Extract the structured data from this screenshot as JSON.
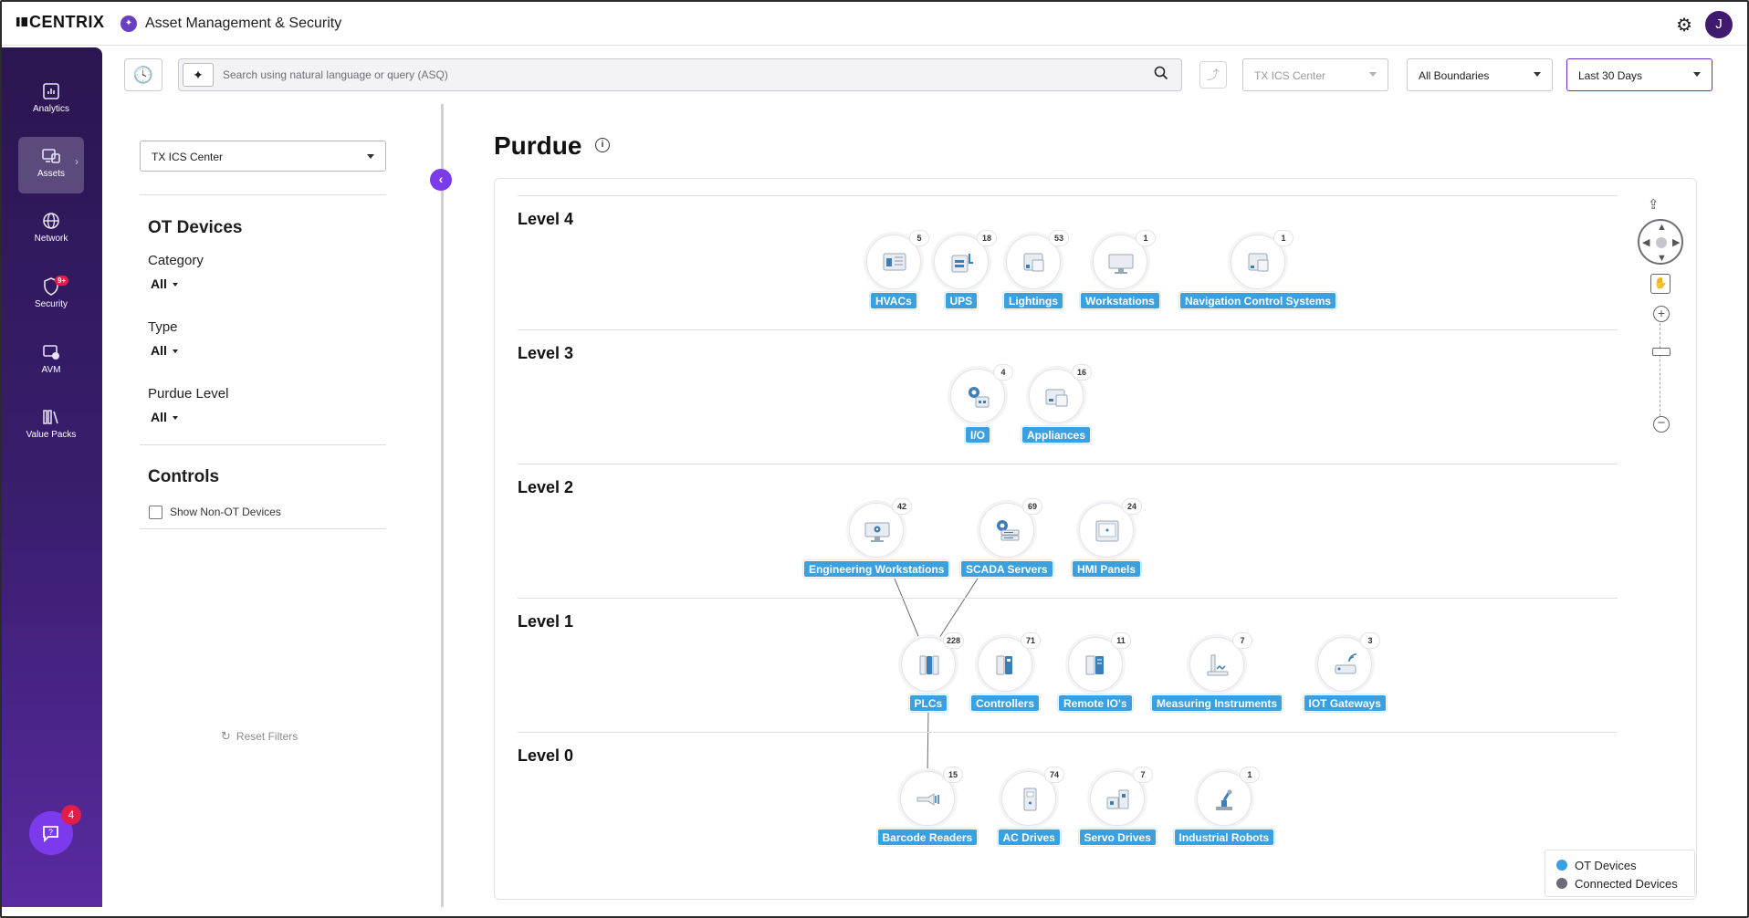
{
  "header": {
    "brand": "CENTRIX",
    "app_title": "Asset Management & Security",
    "avatar_initial": "J"
  },
  "nav": {
    "items": [
      {
        "label": "Analytics",
        "icon": "bar-chart-icon"
      },
      {
        "label": "Assets",
        "icon": "assets-icon",
        "active": true
      },
      {
        "label": "Network",
        "icon": "globe-icon"
      },
      {
        "label": "Security",
        "icon": "shield-icon",
        "badge": "9+"
      },
      {
        "label": "AVM",
        "icon": "avm-icon"
      },
      {
        "label": "Value Packs",
        "icon": "library-icon"
      }
    ],
    "chat_badge": "4"
  },
  "toolbar": {
    "search_placeholder": "Search using natural language or query (ASQ)",
    "site_select": "TX ICS Center",
    "boundary_select": "All Boundaries",
    "time_select": "Last 30 Days"
  },
  "filters": {
    "site": "TX ICS Center",
    "ot_devices_title": "OT Devices",
    "category_label": "Category",
    "category_value": "All",
    "type_label": "Type",
    "type_value": "All",
    "purdue_label": "Purdue Level",
    "purdue_value": "All",
    "controls_title": "Controls",
    "show_non_ot_label": "Show Non-OT Devices",
    "reset_label": "Reset Filters"
  },
  "main": {
    "title": "Purdue",
    "levels": [
      {
        "label": "Level 4",
        "nodes": [
          {
            "name": "HVACs",
            "count": "5",
            "icon": "hvac-icon"
          },
          {
            "name": "UPS",
            "count": "18",
            "icon": "ups-icon"
          },
          {
            "name": "Lightings",
            "count": "53",
            "icon": "lighting-icon"
          },
          {
            "name": "Workstations",
            "count": "1",
            "icon": "workstation-icon"
          },
          {
            "name": "Navigation Control Systems",
            "count": "1",
            "icon": "navigation-control-icon"
          }
        ]
      },
      {
        "label": "Level 3",
        "nodes": [
          {
            "name": "I/O",
            "count": "4",
            "icon": "io-icon"
          },
          {
            "name": "Appliances",
            "count": "16",
            "icon": "appliance-icon"
          }
        ]
      },
      {
        "label": "Level 2",
        "nodes": [
          {
            "name": "Engineering Workstations",
            "count": "42",
            "icon": "engineering-workstation-icon"
          },
          {
            "name": "SCADA Servers",
            "count": "69",
            "icon": "scada-server-icon"
          },
          {
            "name": "HMI Panels",
            "count": "24",
            "icon": "hmi-panel-icon"
          }
        ]
      },
      {
        "label": "Level 1",
        "nodes": [
          {
            "name": "PLCs",
            "count": "228",
            "icon": "plc-icon"
          },
          {
            "name": "Controllers",
            "count": "71",
            "icon": "controller-icon"
          },
          {
            "name": "Remote IO's",
            "count": "11",
            "icon": "remote-io-icon"
          },
          {
            "name": "Measuring Instruments",
            "count": "7",
            "icon": "measuring-instrument-icon"
          },
          {
            "name": "IOT Gateways",
            "count": "3",
            "icon": "iot-gateway-icon"
          }
        ]
      },
      {
        "label": "Level 0",
        "nodes": [
          {
            "name": "Barcode Readers",
            "count": "15",
            "icon": "barcode-reader-icon"
          },
          {
            "name": "AC Drives",
            "count": "74",
            "icon": "ac-drive-icon"
          },
          {
            "name": "Servo Drives",
            "count": "7",
            "icon": "servo-drive-icon"
          },
          {
            "name": "Industrial Robots",
            "count": "1",
            "icon": "industrial-robot-icon"
          }
        ]
      }
    ]
  },
  "legend": {
    "ot_label": "OT Devices",
    "ot_color": "#3aa0e0",
    "connected_label": "Connected Devices",
    "connected_color": "#6b6b7a"
  }
}
